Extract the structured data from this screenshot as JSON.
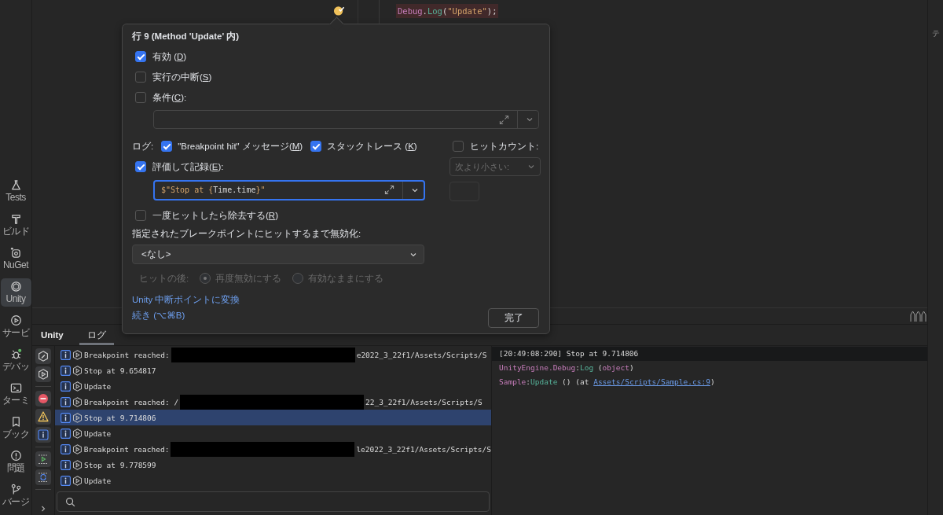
{
  "activity_bar": [
    {
      "label": "Tests",
      "selected": false
    },
    {
      "label": "ビルド",
      "selected": false
    },
    {
      "label": "NuGet",
      "selected": false
    },
    {
      "label": "Unity",
      "selected": true
    },
    {
      "label": "サービ",
      "selected": false
    },
    {
      "label": "デバッ",
      "selected": false
    },
    {
      "label": "ターミ",
      "selected": false
    },
    {
      "label": "ブック",
      "selected": false
    },
    {
      "label": "問題",
      "selected": false
    },
    {
      "label": "バージ",
      "selected": false
    }
  ],
  "editor": {
    "code_line": [
      {
        "text": "Debug",
        "kind": "type"
      },
      {
        "text": ".",
        "kind": "plain"
      },
      {
        "text": "Log",
        "kind": "method"
      },
      {
        "text": "(",
        "kind": "plain"
      },
      {
        "text": "\"Update\"",
        "kind": "string"
      },
      {
        "text": ");",
        "kind": "plain"
      }
    ],
    "side_label": "テ"
  },
  "breakpoint_popup": {
    "title": "行 9 (Method 'Update' 内)",
    "checks": [
      {
        "before": "有効 (",
        "mn": "D",
        "after": ")",
        "checked": true
      },
      {
        "before": "実行の中断(",
        "mn": "S",
        "after": ")",
        "checked": false
      },
      {
        "before": "条件(",
        "mn": "C",
        "after": "):",
        "checked": false
      }
    ],
    "log": {
      "label": "ログ:",
      "options": [
        {
          "before": "\"Breakpoint hit\" メッセージ(",
          "mn": "M",
          "after": ")",
          "checked": true
        },
        {
          "before": "スタックトレース (",
          "mn": "K",
          "after": ")",
          "checked": true
        }
      ]
    },
    "hit_count": {
      "before": "ヒットカウント:",
      "checked": false,
      "comparison": "次より小さい:",
      "disabled": true
    },
    "evaluate": {
      "before": "評価して記録(",
      "mn": "E",
      "after": "):",
      "checked": true,
      "expression": [
        {
          "text": "$\"Stop at {",
          "kind": "string"
        },
        {
          "text": "Time.time",
          "kind": "plain"
        },
        {
          "text": "}\"",
          "kind": "string"
        }
      ]
    },
    "remove_once": {
      "before": "一度ヒットしたら除去する(",
      "mn": "R",
      "after": ")",
      "checked": false
    },
    "disable_until": {
      "label": "指定されたブレークポイントにヒットするまで無効化:",
      "value": "<なし>"
    },
    "after_hit": {
      "label": "ヒットの後:",
      "disabled": true,
      "options": [
        {
          "label": "再度無効にする",
          "selected": true
        },
        {
          "label": "有効なままにする",
          "selected": false
        }
      ]
    },
    "convert_link": "Unity 中断ポイントに変換",
    "continue_link": "続き (⌥⌘B)",
    "done_button": "完了"
  },
  "bottom_panel": {
    "title": "Unity",
    "tabs": [
      {
        "label": "ログ",
        "selected": true
      }
    ],
    "log_rows": [
      {
        "text": "Breakpoint reached: ",
        "redacted": true,
        "suffix": "e2022_3_22f1/Assets/Scripts/S",
        "selected": false
      },
      {
        "text": "Stop at 9.654817",
        "redacted": false,
        "selected": false
      },
      {
        "text": "Update",
        "redacted": false,
        "selected": false
      },
      {
        "text": "Breakpoint reached: /",
        "redacted": true,
        "suffix": "22_3_22f1/Assets/Scripts/S",
        "selected": false
      },
      {
        "text": "Stop at 9.714806",
        "redacted": false,
        "selected": true
      },
      {
        "text": "Update",
        "redacted": false,
        "selected": false
      },
      {
        "text": "Breakpoint reached: ",
        "redacted": true,
        "suffix": "le2022_3_22f1/Assets/Scripts/S",
        "selected": false
      },
      {
        "text": "Stop at 9.778599",
        "redacted": false,
        "selected": false
      },
      {
        "text": "Update",
        "redacted": false,
        "selected": false
      }
    ],
    "detail": [
      {
        "highlighted": true,
        "parts": [
          {
            "text": "[20:49:08:290] Stop at 9.714806",
            "kind": "plain"
          }
        ]
      },
      {
        "highlighted": false,
        "parts": [
          {
            "text": "UnityEngine.Debug",
            "kind": "type"
          },
          {
            "text": ":",
            "kind": "plain"
          },
          {
            "text": "Log",
            "kind": "method"
          },
          {
            "text": " (",
            "kind": "plain"
          },
          {
            "text": "object",
            "kind": "type"
          },
          {
            "text": ")",
            "kind": "plain"
          }
        ]
      },
      {
        "highlighted": false,
        "parts": [
          {
            "text": "Sample",
            "kind": "type"
          },
          {
            "text": ":",
            "kind": "plain"
          },
          {
            "text": "Update",
            "kind": "method"
          },
          {
            "text": " () (at ",
            "kind": "plain"
          },
          {
            "text": "Assets/Scripts/Sample.cs:9",
            "kind": "link"
          },
          {
            "text": ")",
            "kind": "plain"
          }
        ]
      }
    ]
  }
}
